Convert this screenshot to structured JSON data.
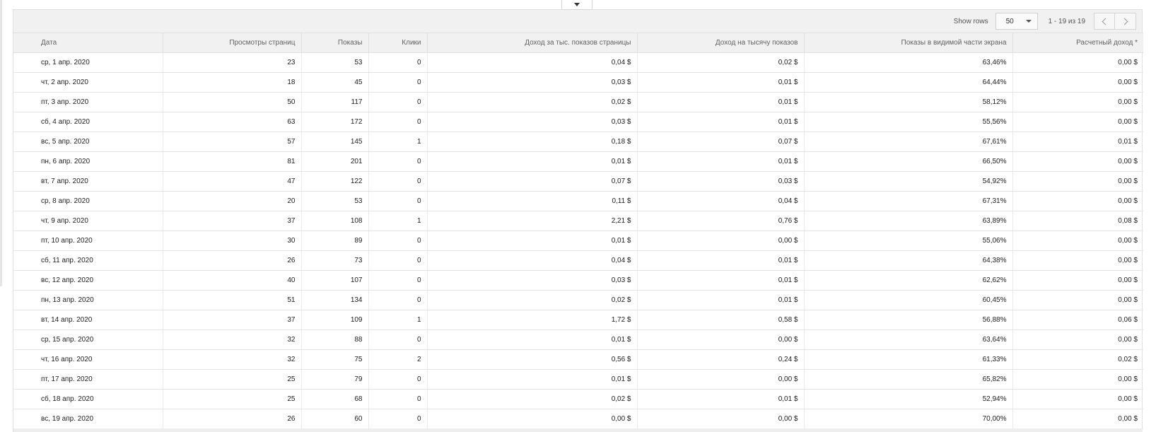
{
  "collapse_icon": "caret-down-icon",
  "toolbar": {
    "show_rows_label": "Show rows",
    "rows_value": "50",
    "page_range": "1 - 19 из 19",
    "prev_icon": "chevron-left-icon",
    "next_icon": "chevron-right-icon"
  },
  "table": {
    "headers": [
      "Дата",
      "Просмотры страниц",
      "Показы",
      "Клики",
      "Доход за тыс. показов страницы",
      "Доход на тысячу показов",
      "Показы в видимой части экрана",
      "Расчетный доход *"
    ],
    "rows": [
      [
        "ср, 1 апр. 2020",
        "23",
        "53",
        "0",
        "0,04 $",
        "0,02 $",
        "63,46%",
        "0,00 $"
      ],
      [
        "чт, 2 апр. 2020",
        "18",
        "45",
        "0",
        "0,03 $",
        "0,01 $",
        "64,44%",
        "0,00 $"
      ],
      [
        "пт, 3 апр. 2020",
        "50",
        "117",
        "0",
        "0,02 $",
        "0,01 $",
        "58,12%",
        "0,00 $"
      ],
      [
        "сб, 4 апр. 2020",
        "63",
        "172",
        "0",
        "0,03 $",
        "0,01 $",
        "55,56%",
        "0,00 $"
      ],
      [
        "вс, 5 апр. 2020",
        "57",
        "145",
        "1",
        "0,18 $",
        "0,07 $",
        "67,61%",
        "0,01 $"
      ],
      [
        "пн, 6 апр. 2020",
        "81",
        "201",
        "0",
        "0,01 $",
        "0,01 $",
        "66,50%",
        "0,00 $"
      ],
      [
        "вт, 7 апр. 2020",
        "47",
        "122",
        "0",
        "0,07 $",
        "0,03 $",
        "54,92%",
        "0,00 $"
      ],
      [
        "ср, 8 апр. 2020",
        "20",
        "53",
        "0",
        "0,11 $",
        "0,04 $",
        "67,31%",
        "0,00 $"
      ],
      [
        "чт, 9 апр. 2020",
        "37",
        "108",
        "1",
        "2,21 $",
        "0,76 $",
        "63,89%",
        "0,08 $"
      ],
      [
        "пт, 10 апр. 2020",
        "30",
        "89",
        "0",
        "0,01 $",
        "0,00 $",
        "55,06%",
        "0,00 $"
      ],
      [
        "сб, 11 апр. 2020",
        "26",
        "73",
        "0",
        "0,04 $",
        "0,01 $",
        "64,38%",
        "0,00 $"
      ],
      [
        "вс, 12 апр. 2020",
        "40",
        "107",
        "0",
        "0,03 $",
        "0,01 $",
        "62,62%",
        "0,00 $"
      ],
      [
        "пн, 13 апр. 2020",
        "51",
        "134",
        "0",
        "0,02 $",
        "0,01 $",
        "60,45%",
        "0,00 $"
      ],
      [
        "вт, 14 апр. 2020",
        "37",
        "109",
        "1",
        "1,72 $",
        "0,58 $",
        "56,88%",
        "0,06 $"
      ],
      [
        "ср, 15 апр. 2020",
        "32",
        "88",
        "0",
        "0,01 $",
        "0,00 $",
        "63,64%",
        "0,00 $"
      ],
      [
        "чт, 16 апр. 2020",
        "32",
        "75",
        "2",
        "0,56 $",
        "0,24 $",
        "61,33%",
        "0,02 $"
      ],
      [
        "пт, 17 апр. 2020",
        "25",
        "79",
        "0",
        "0,01 $",
        "0,00 $",
        "65,82%",
        "0,00 $"
      ],
      [
        "сб, 18 апр. 2020",
        "25",
        "68",
        "0",
        "0,02 $",
        "0,01 $",
        "52,94%",
        "0,00 $"
      ],
      [
        "вс, 19 апр. 2020",
        "26",
        "60",
        "0",
        "0,00 $",
        "0,00 $",
        "70,00%",
        "0,00 $"
      ]
    ]
  }
}
